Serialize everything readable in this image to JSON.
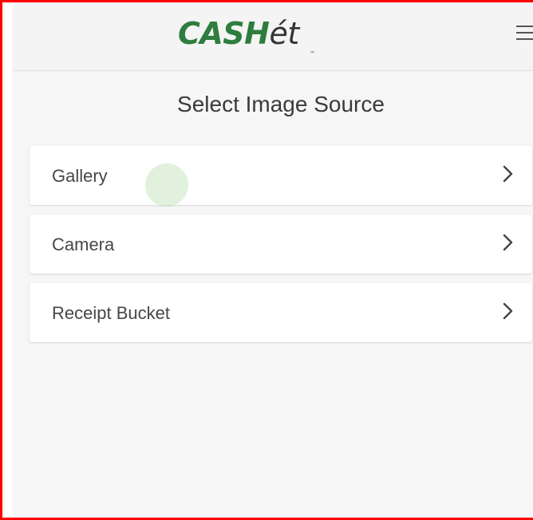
{
  "header": {
    "logo_main": "CASH",
    "logo_accent": "ét",
    "logo_tm": "™",
    "menu_icon": "hamburger-menu-icon"
  },
  "page": {
    "title": "Select Image Source"
  },
  "sources": {
    "items": [
      {
        "label": "Gallery",
        "icon": "chevron-right-icon"
      },
      {
        "label": "Camera",
        "icon": "chevron-right-icon"
      },
      {
        "label": "Receipt Bucket",
        "icon": "chevron-right-icon"
      }
    ]
  },
  "colors": {
    "brand_green": "#2e7d3e",
    "frame_border": "#ff0000",
    "touch_ripple": "#aad6a0"
  }
}
